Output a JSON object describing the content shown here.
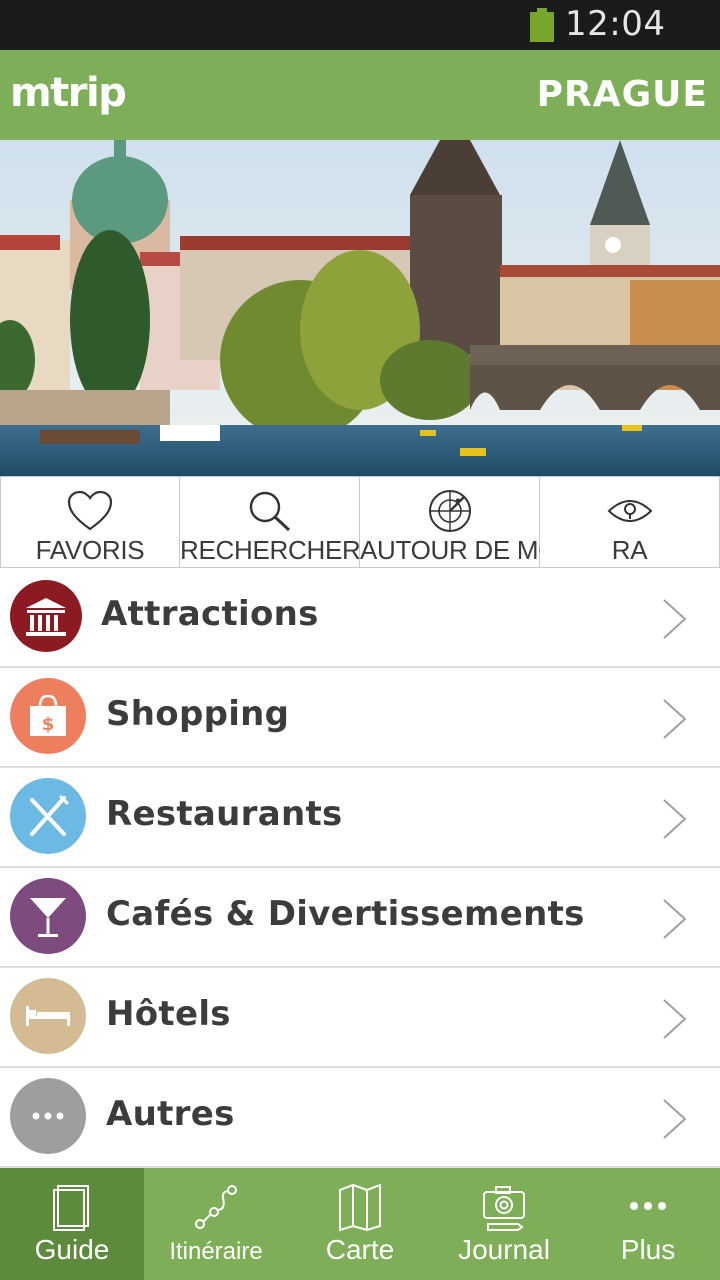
{
  "status_bar": {
    "time": "12:04 PM",
    "battery_icon": "battery-icon"
  },
  "app_bar": {
    "logo": "mtrip",
    "city": "PRAGUE"
  },
  "quick_actions": [
    {
      "label": "FAVORIS",
      "icon": "heart-icon"
    },
    {
      "label": "RECHERCHER",
      "icon": "search-icon"
    },
    {
      "label": "AUTOUR DE MOI",
      "icon": "radar-icon"
    },
    {
      "label": "RA",
      "icon": "eye-icon"
    }
  ],
  "categories": [
    {
      "label": "Attractions",
      "icon": "museum-icon",
      "color": "#8b1a22"
    },
    {
      "label": "Shopping",
      "icon": "shopping-bag-icon",
      "color": "#ee7f5e"
    },
    {
      "label": "Restaurants",
      "icon": "fork-knife-icon",
      "color": "#6cb9e4"
    },
    {
      "label": "Cafés & Divertissements",
      "icon": "cocktail-icon",
      "color": "#7e4b7e"
    },
    {
      "label": "Hôtels",
      "icon": "bed-icon",
      "color": "#d4bb94"
    },
    {
      "label": "Autres",
      "icon": "more-icon",
      "color": "#9e9e9e"
    }
  ],
  "tab_bar": [
    {
      "label": "Guide",
      "icon": "book-icon",
      "active": true
    },
    {
      "label": "Itinéraire",
      "icon": "route-icon",
      "active": false
    },
    {
      "label": "Carte",
      "icon": "map-icon",
      "active": false
    },
    {
      "label": "Journal",
      "icon": "camera-icon",
      "active": false
    },
    {
      "label": "Plus",
      "icon": "more-dots-icon",
      "active": false
    }
  ],
  "colors": {
    "brand_green": "#7fae59",
    "active_tab": "#5d8a3d",
    "status_bar": "#1b1b1b"
  }
}
